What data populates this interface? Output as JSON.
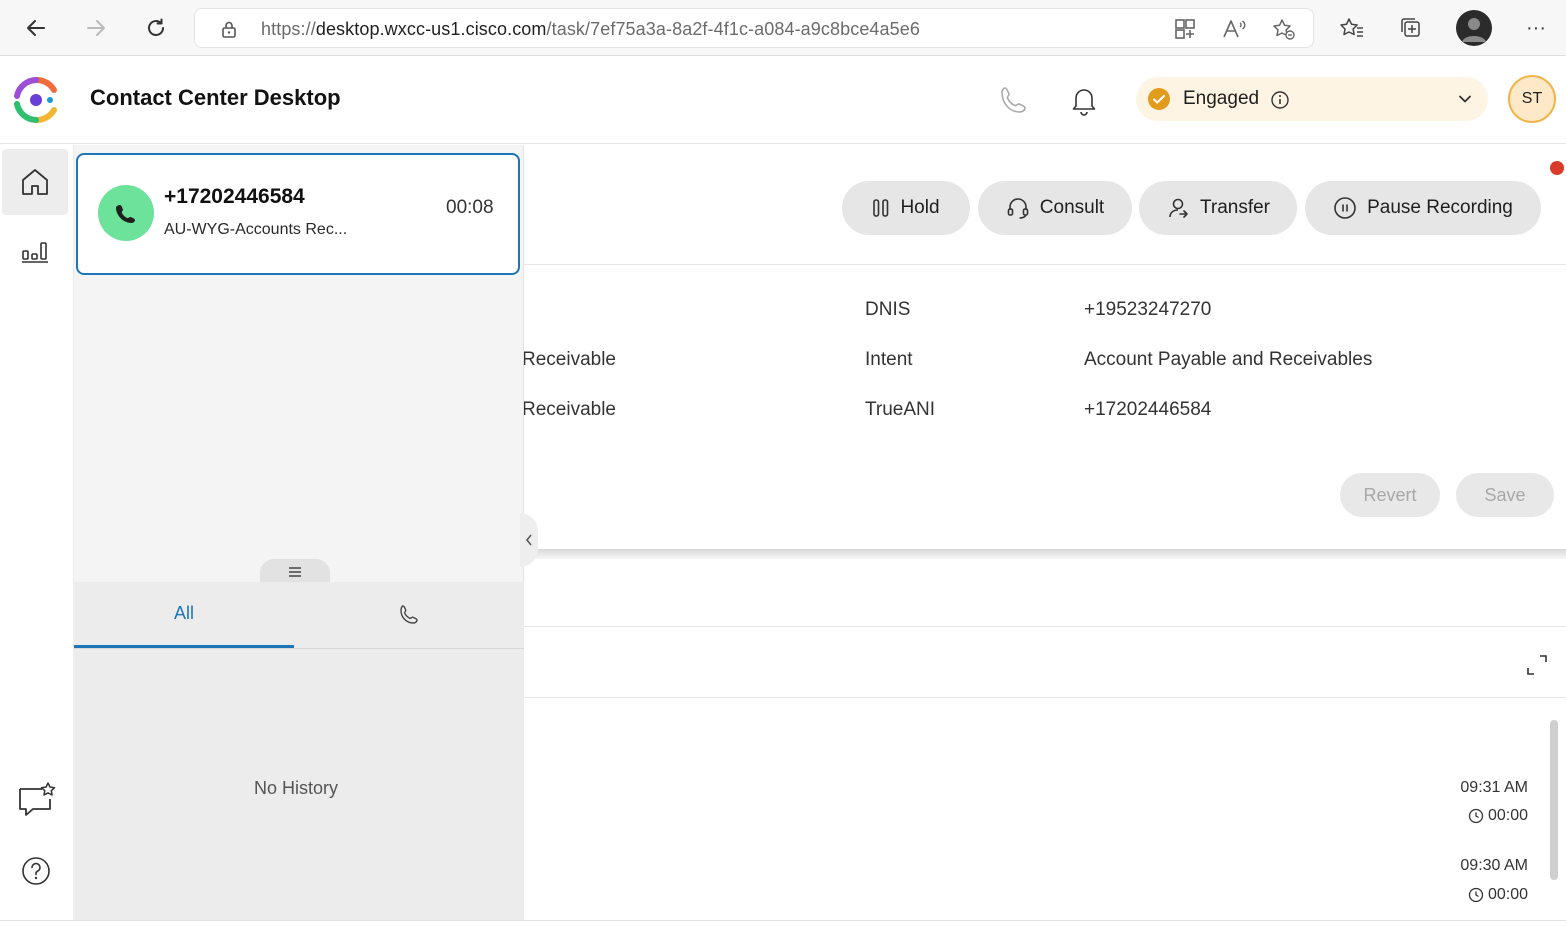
{
  "browser": {
    "url_prefix": "https://",
    "url_domain": "desktop.wxcc-us1.cisco.com",
    "url_path": "/task/7ef75a3a-8a2f-4f1c-a084-a9c8bce4a5e6",
    "more_label": "···"
  },
  "header": {
    "title": "Contact Center Desktop",
    "state_label": "Engaged",
    "avatar_initials": "ST"
  },
  "task": {
    "number": "+17202446584",
    "queue": "AU-WYG-Accounts Rec...",
    "timer": "00:08"
  },
  "controls": {
    "hold": "Hold",
    "consult": "Consult",
    "transfer": "Transfer",
    "pause_recording": "Pause Recording"
  },
  "cad": {
    "rows": [
      {
        "left_value": "",
        "key": "DNIS",
        "value": "+19523247270"
      },
      {
        "left_value": "Receivable",
        "key": "Intent",
        "value": "Account Payable and Receivables"
      },
      {
        "left_value": "Receivable",
        "key": "TrueANI",
        "value": "+17202446584"
      }
    ],
    "revert_label": "Revert",
    "save_label": "Save"
  },
  "history_panel": {
    "tab_all": "All",
    "empty_text": "No History"
  },
  "history": [
    {
      "time": "09:31 AM",
      "duration": "00:00"
    },
    {
      "time": "09:30 AM",
      "duration": "00:00"
    }
  ],
  "colors": {
    "accent": "#1d76b8",
    "call_green": "#6ce29a",
    "state_bg": "#fdf4e3",
    "state_check": "#e39b1b"
  }
}
